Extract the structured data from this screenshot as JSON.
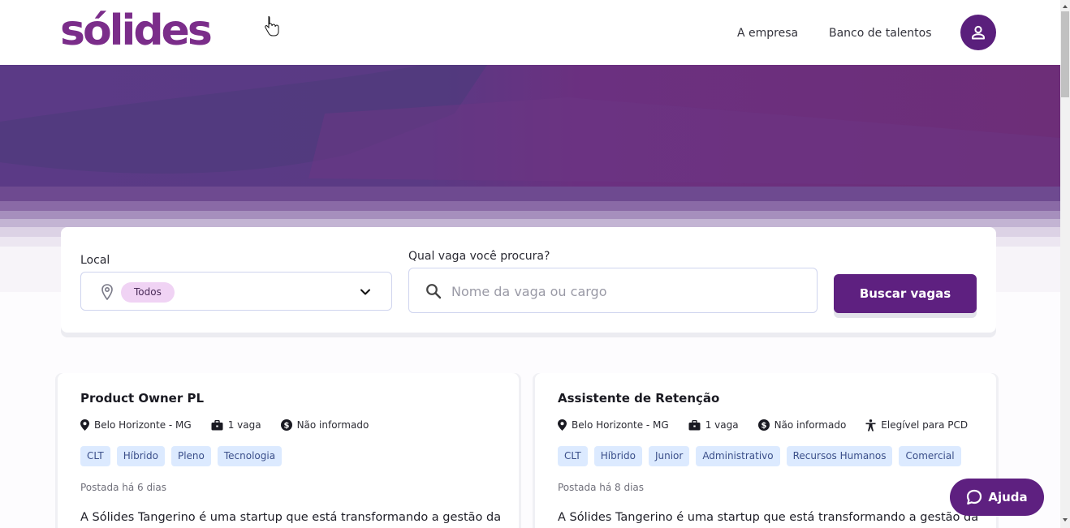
{
  "header": {
    "logo_text": "sólides",
    "nav": [
      "A empresa",
      "Banco de talentos"
    ],
    "avatar_icon": "user-icon"
  },
  "colors": {
    "brand_purple": "#5e2080",
    "logo_purple": "#7b2d8a",
    "chip_pink": "#f0d3f4",
    "tag_blue": "#dceaff"
  },
  "search": {
    "local_label": "Local",
    "local_value": "Todos",
    "vaga_label": "Qual vaga você procura?",
    "vaga_placeholder": "Nome da vaga ou cargo",
    "button_label": "Buscar vagas"
  },
  "jobs": [
    {
      "title": "Product Owner PL",
      "location": "Belo Horizonte - MG",
      "openings": "1 vaga",
      "salary": "Não informado",
      "tags": [
        "CLT",
        "Híbrido",
        "Pleno",
        "Tecnologia"
      ],
      "posted": "Postada há 6 dias",
      "description": "A Sólides Tangerino é uma startup que está transformando a gestão da"
    },
    {
      "title": "Assistente de Retenção",
      "location": "Belo Horizonte - MG",
      "openings": "1 vaga",
      "salary": "Não informado",
      "pcd": "Elegível para PCD",
      "tags": [
        "CLT",
        "Híbrido",
        "Junior",
        "Administrativo",
        "Recursos Humanos",
        "Comercial"
      ],
      "posted": "Postada há 8 dias",
      "description": "A Sólides Tangerino é uma startup que está transformando a gestão da"
    }
  ],
  "help": {
    "label": "Ajuda"
  }
}
